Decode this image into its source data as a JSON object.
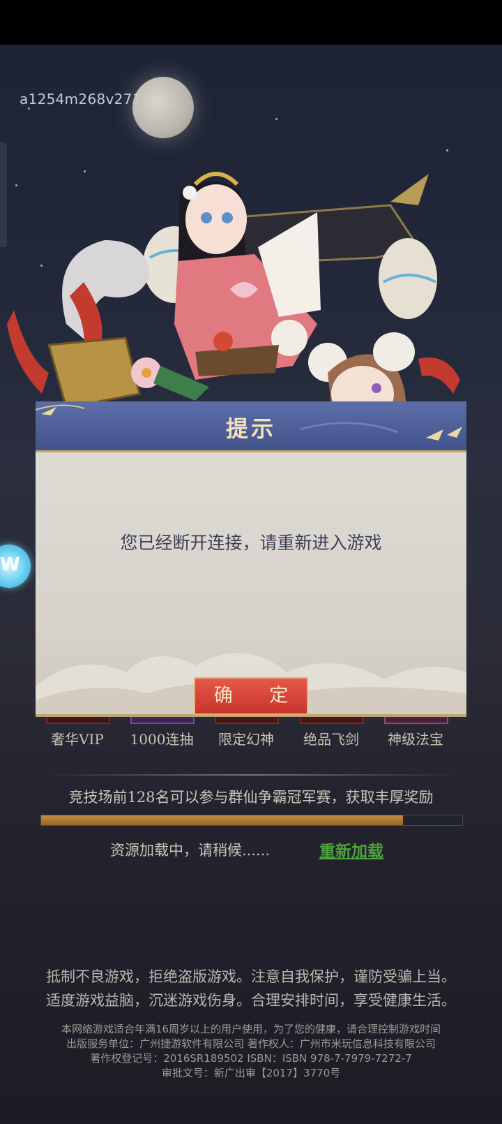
{
  "build_id": "a1254m268v271",
  "dialog": {
    "title": "提示",
    "message": "您已经断开连接，请重新进入游戏",
    "confirm_label": "确 定"
  },
  "rewards": [
    {
      "label": "奢华VIP",
      "icon": "vip-badge-icon"
    },
    {
      "label": "1000连抽",
      "icon": "draw-icon"
    },
    {
      "label": "限定幻神",
      "icon": "card-icon"
    },
    {
      "label": "绝品飞剑",
      "icon": "sword-icon"
    },
    {
      "label": "神级法宝",
      "icon": "treasure-icon"
    }
  ],
  "tip": "竞技场前128名可以参与群仙争霸冠军赛，获取丰厚奖励",
  "loading": {
    "progress": 0.86,
    "text": "资源加载中，请稍候......",
    "reload_label": "重新加载"
  },
  "health_notice": [
    "抵制不良游戏，拒绝盗版游戏。注意自我保护，谨防受骗上当。",
    "适度游戏益脑，沉迷游戏伤身。合理安排时间，享受健康生活。"
  ],
  "legal": [
    "本网络游戏适合年满16周岁以上的用户使用，为了您的健康，请合理控制游戏时间",
    "出版服务单位：广州捷游软件有限公司 著作权人：广州市米玩信息科技有限公司",
    "著作权登记号：2016SR189502 ISBN：ISBN 978-7-7979-7272-7",
    "审批文号：新广出审【2017】3770号"
  ],
  "colors": {
    "dialog_header": "#4d5e98",
    "confirm_button": "#d6413a",
    "reload_link": "#4da33b",
    "progress_fill": "#b57b34"
  }
}
